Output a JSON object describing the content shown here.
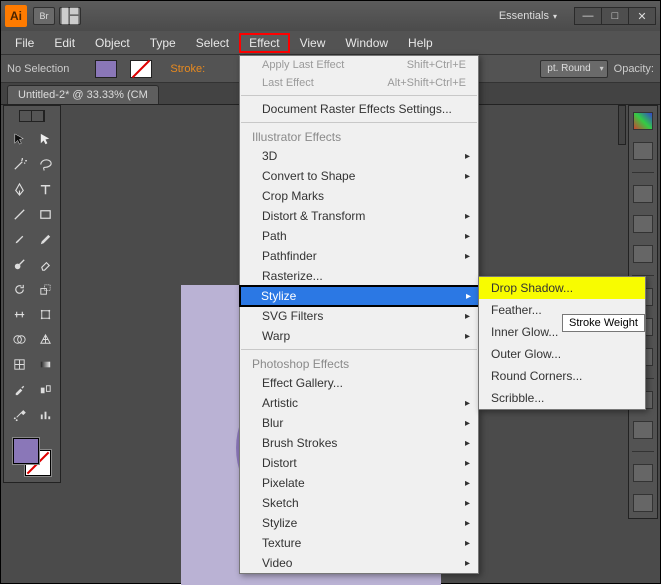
{
  "titlebar": {
    "app_abbrev": "Ai",
    "br_label": "Br",
    "workspace": "Essentials"
  },
  "menubar": [
    "File",
    "Edit",
    "Object",
    "Type",
    "Select",
    "Effect",
    "View",
    "Window",
    "Help"
  ],
  "controlbar": {
    "selection": "No Selection",
    "stroke_label": "Stroke:",
    "cap": "pt. Round",
    "opacity": "Opacity:"
  },
  "tab": "Untitled-2* @ 33.33% (CM",
  "effect_menu": {
    "apply_last": "Apply Last Effect",
    "apply_last_sc": "Shift+Ctrl+E",
    "last_effect": "Last Effect",
    "last_effect_sc": "Alt+Shift+Ctrl+E",
    "raster_settings": "Document Raster Effects Settings...",
    "hdr_ill": "Illustrator Effects",
    "items_ill": [
      "3D",
      "Convert to Shape",
      "Crop Marks",
      "Distort & Transform",
      "Path",
      "Pathfinder",
      "Rasterize...",
      "Stylize",
      "SVG Filters",
      "Warp"
    ],
    "hdr_ps": "Photoshop Effects",
    "items_ps": [
      "Effect Gallery...",
      "Artistic",
      "Blur",
      "Brush Strokes",
      "Distort",
      "Pixelate",
      "Sketch",
      "Stylize",
      "Texture",
      "Video"
    ]
  },
  "stylize_submenu": [
    "Drop Shadow...",
    "Feather...",
    "Inner Glow...",
    "Outer Glow...",
    "Round Corners...",
    "Scribble..."
  ],
  "tooltip": "Stroke Weight"
}
